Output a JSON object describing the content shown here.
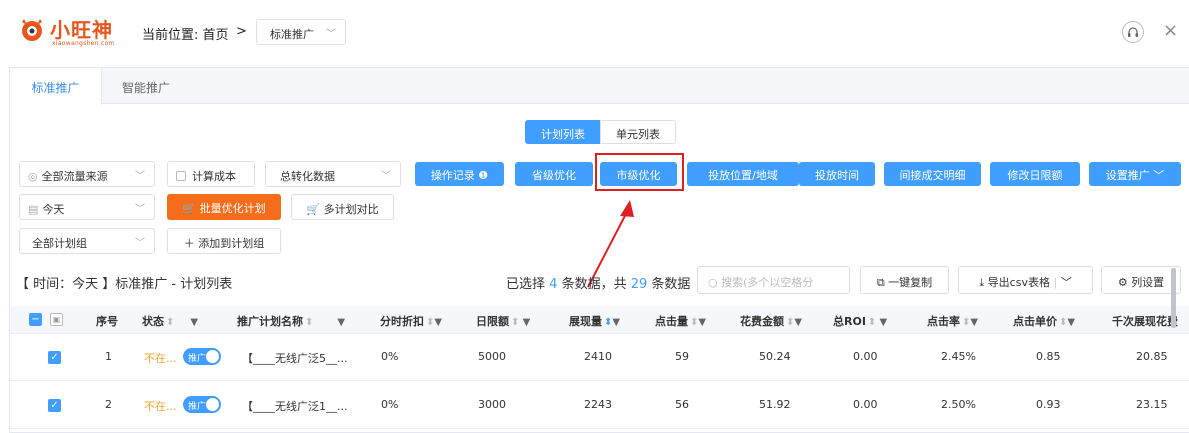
{
  "logo": {
    "name": "小旺神",
    "domain": "xiaowangshen.com"
  },
  "breadcrumb": {
    "prefix": "当前位置: 首页",
    "sep": ">",
    "current": "标准推广"
  },
  "tabs": [
    "标准推广",
    "智能推广"
  ],
  "view_toggle": [
    "计划列表",
    "单元列表"
  ],
  "filters": {
    "traffic": "全部流量来源",
    "cost_checkbox": "计算成本",
    "conversion": "总转化数据",
    "date": "今天",
    "plan_group": "全部计划组"
  },
  "actions": {
    "op_log": "操作记录 ❶",
    "province": "省级优化",
    "city": "市级优化",
    "placement": "投放位置/地域",
    "time": "投放时间",
    "indirect": "间接成交明细",
    "daily_limit": "修改日限额",
    "settings": "设置推广"
  },
  "batch": {
    "optimize": "批量优化计划",
    "compare": "多计划对比",
    "add_group": "添加到计划组"
  },
  "summary": {
    "left": "【 时间：今天 】标准推广 - 计划列表",
    "sel_prefix": "已选择",
    "sel_count": "4",
    "sel_mid": "条数据，共",
    "total": "29",
    "sel_suffix": "条数据"
  },
  "toolbar": {
    "search_placeholder": "搜索(多个以空格分",
    "copy": "一键复制",
    "export": "导出csv表格",
    "columns": "列设置"
  },
  "table": {
    "headers": [
      "序号",
      "状态",
      "推广计划名称",
      "分时折扣",
      "日限额",
      "展现量",
      "点击量",
      "花费金额",
      "总ROI",
      "点击率",
      "点击单价",
      "千次展现花费"
    ],
    "rows": [
      {
        "idx": "1",
        "status": "不在...",
        "toggle": "推广",
        "name": "【____无线广泛5__...",
        "discount": "0%",
        "limit": "5000",
        "impressions": "2410",
        "clicks": "59",
        "cost": "50.24",
        "roi": "0.00",
        "ctr": "2.45%",
        "cpc": "0.85",
        "cpm": "20.85"
      },
      {
        "idx": "2",
        "status": "不在...",
        "toggle": "推广",
        "name": "【____无线广泛1__...",
        "discount": "0%",
        "limit": "3000",
        "impressions": "2243",
        "clicks": "56",
        "cost": "51.92",
        "roi": "0.00",
        "ctr": "2.50%",
        "cpc": "0.93",
        "cpm": "23.15"
      }
    ]
  },
  "colors": {
    "primary": "#409eff",
    "brand": "#e8561e",
    "highlight": "#e02020",
    "status": "#f5a623"
  }
}
